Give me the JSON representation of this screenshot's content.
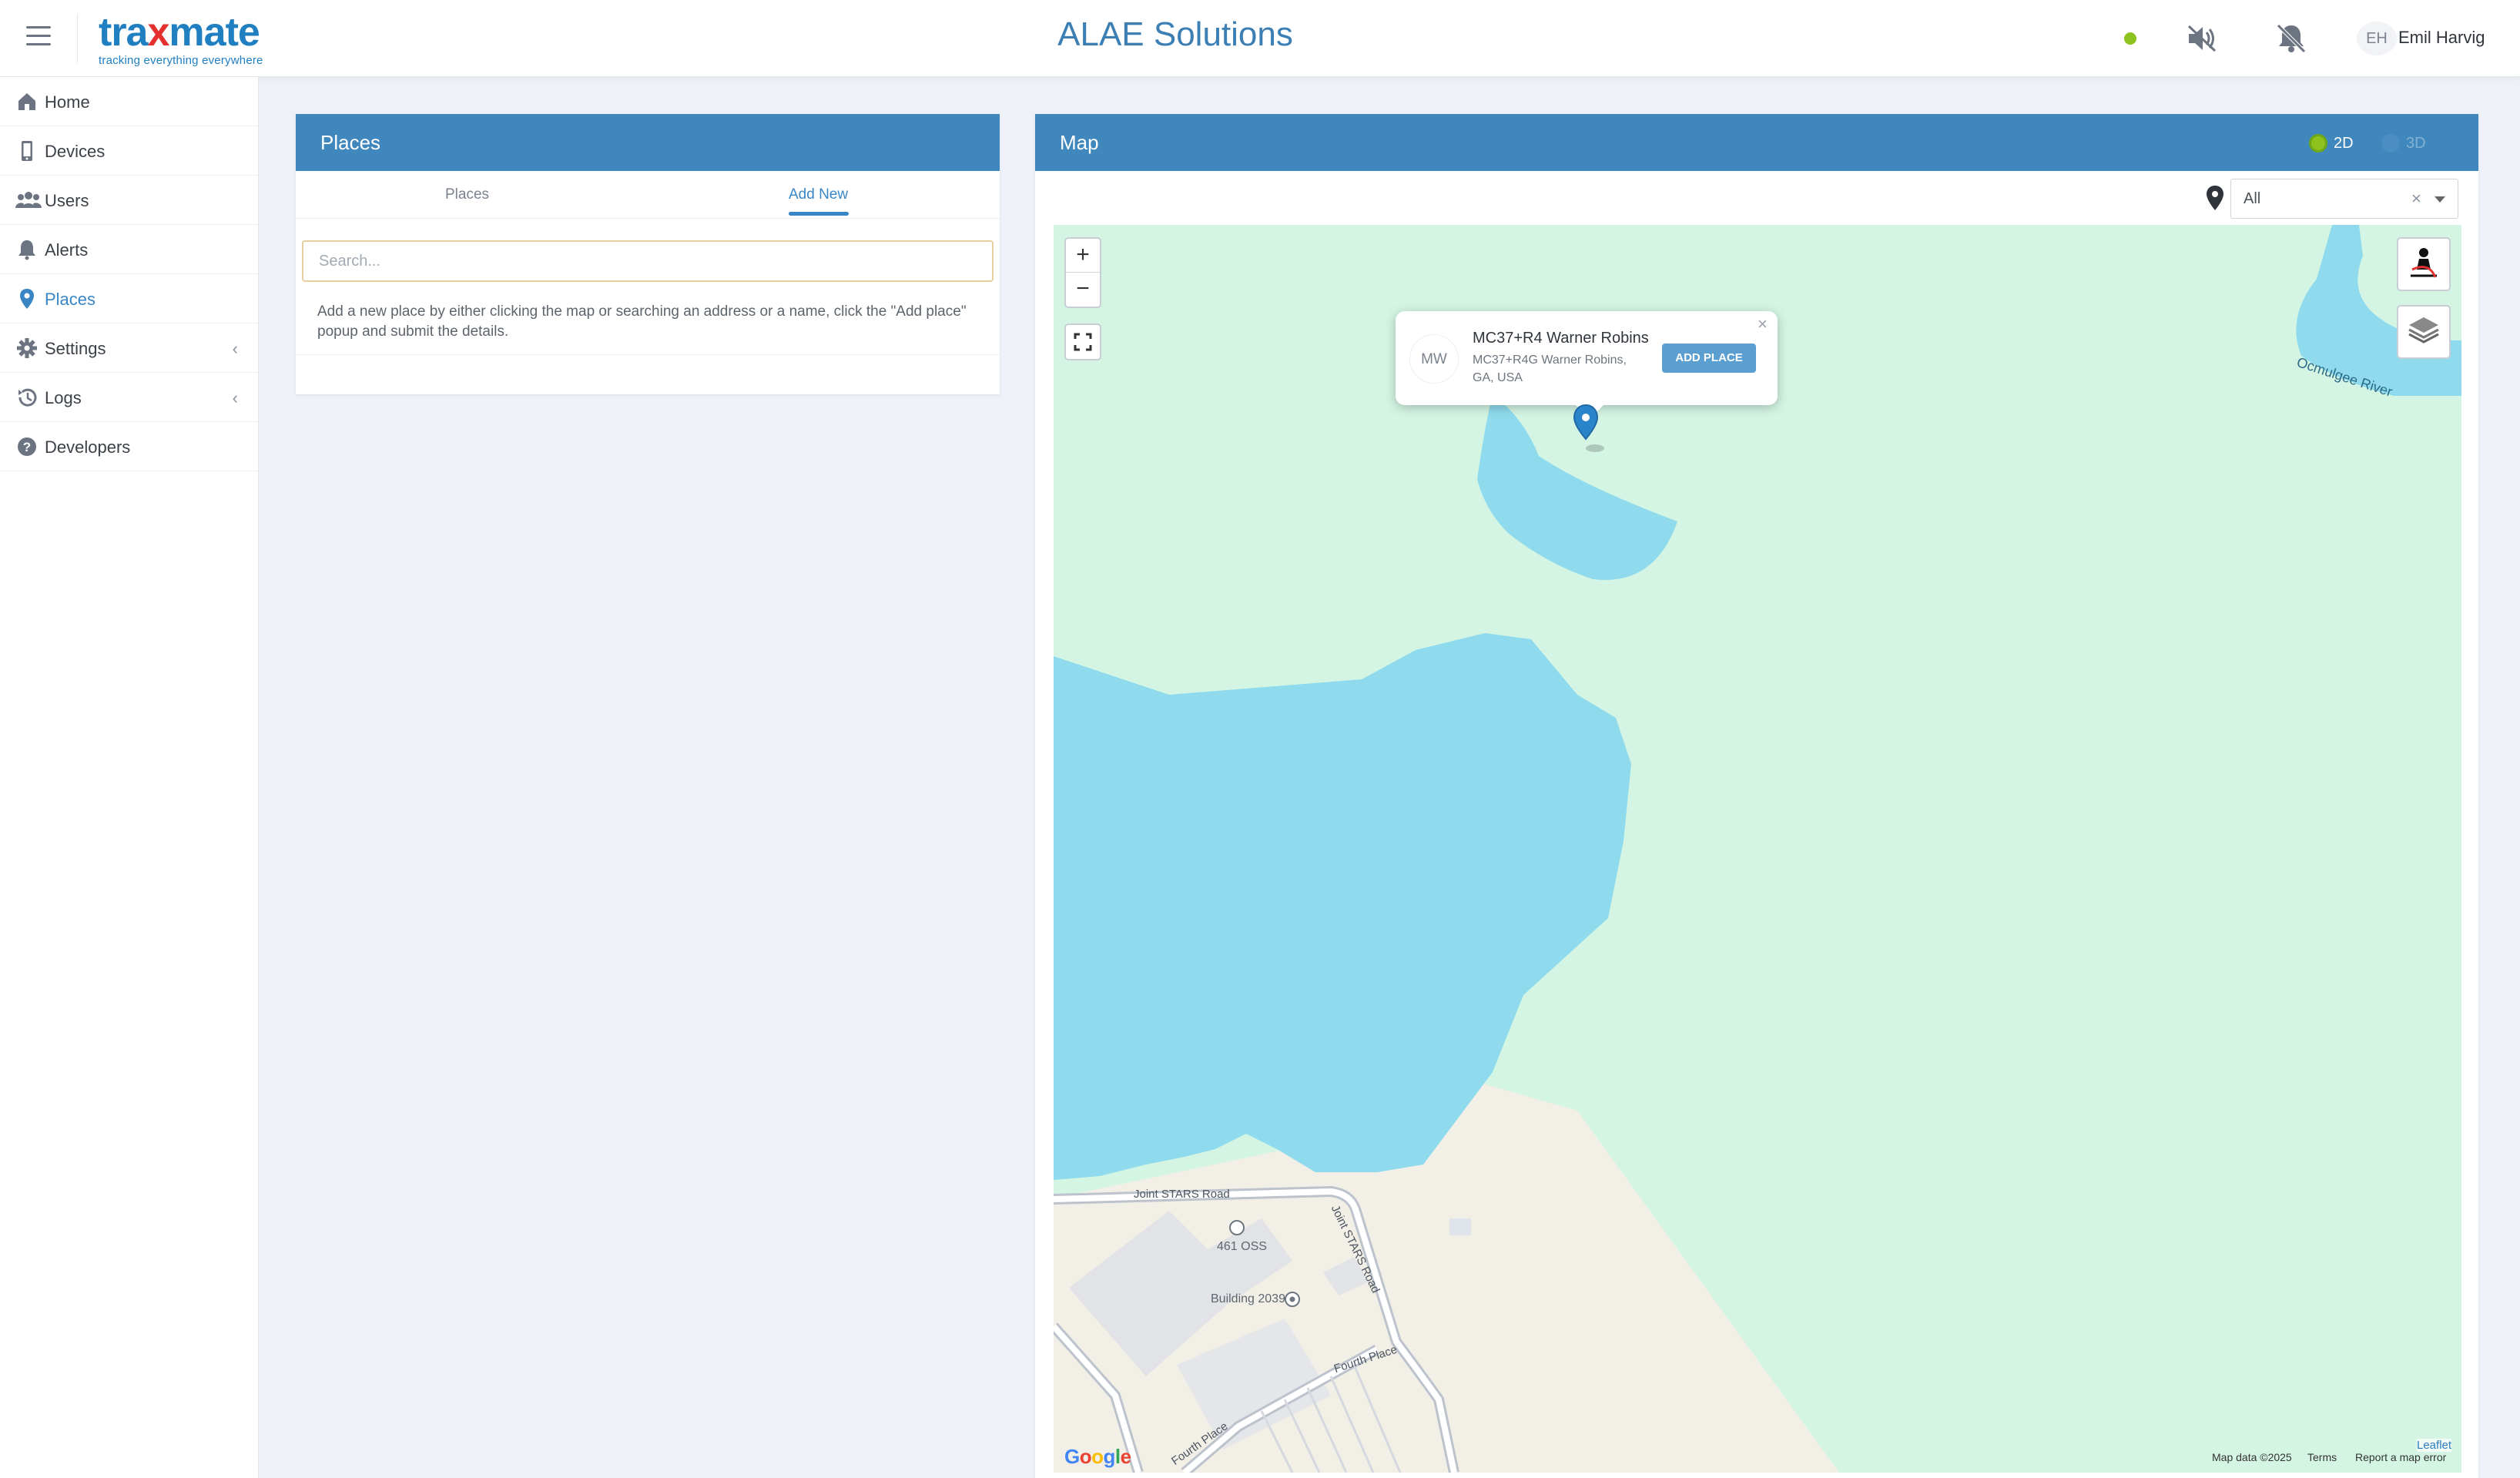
{
  "header": {
    "brand_word_1": "tra",
    "brand_word_x": "x",
    "brand_word_2": "mate",
    "brand_tagline": "tracking everything everywhere",
    "app_title": "ALAE Solutions",
    "user_initials": "EH",
    "user_name": "Emil Harvig",
    "status_color": "#8dc21f",
    "icons": [
      "menu-icon",
      "connection-status-dot",
      "sound-off-icon",
      "notifications-off-icon"
    ]
  },
  "sidebar": {
    "items": [
      {
        "label": "Home",
        "icon": "home-icon"
      },
      {
        "label": "Devices",
        "icon": "device-icon"
      },
      {
        "label": "Users",
        "icon": "users-icon"
      },
      {
        "label": "Alerts",
        "icon": "bell-icon"
      },
      {
        "label": "Places",
        "icon": "location-pin-icon",
        "active": true
      },
      {
        "label": "Settings",
        "icon": "gear-icon",
        "expandable": true
      },
      {
        "label": "Logs",
        "icon": "history-icon",
        "expandable": true
      },
      {
        "label": "Developers",
        "icon": "question-icon"
      }
    ],
    "chevron": "‹"
  },
  "places_panel": {
    "title": "Places",
    "tabs": [
      "Places",
      "Add New"
    ],
    "active_tab": "Add New",
    "search_placeholder": "Search...",
    "help_text": "Add a new place by either clicking the map or searching an address or a name, click the \"Add place\" popup and submit the details."
  },
  "map_panel": {
    "title": "Map",
    "toggle_2d": "2D",
    "toggle_3d": "3D",
    "active_mode": "2D",
    "filter_value": "All",
    "filter_clear": "×",
    "zoom_in": "+",
    "zoom_out": "−",
    "popup": {
      "avatar": "MW",
      "title": "MC37+R4 Warner Robins",
      "subtitle": "MC37+R4G Warner Robins, GA, USA",
      "button": "ADD PLACE",
      "close": "×"
    },
    "labels": {
      "river": "Ocmulgee River",
      "road_1": "Joint STARS Road",
      "road_2": "Joint STARS Road",
      "road_3": "Fourth Place",
      "road_4": "Fourth Place",
      "poi_1": "461 OSS",
      "poi_2": "Building 2039"
    },
    "attribution": {
      "google": "Google",
      "map_data": "Map data ©2025",
      "terms": "Terms",
      "report": "Report a map error",
      "leaflet": "Leaflet"
    },
    "colors": {
      "water": "#8fdbed",
      "land": "#d4f5e4",
      "urban": "#f2efe6"
    }
  }
}
